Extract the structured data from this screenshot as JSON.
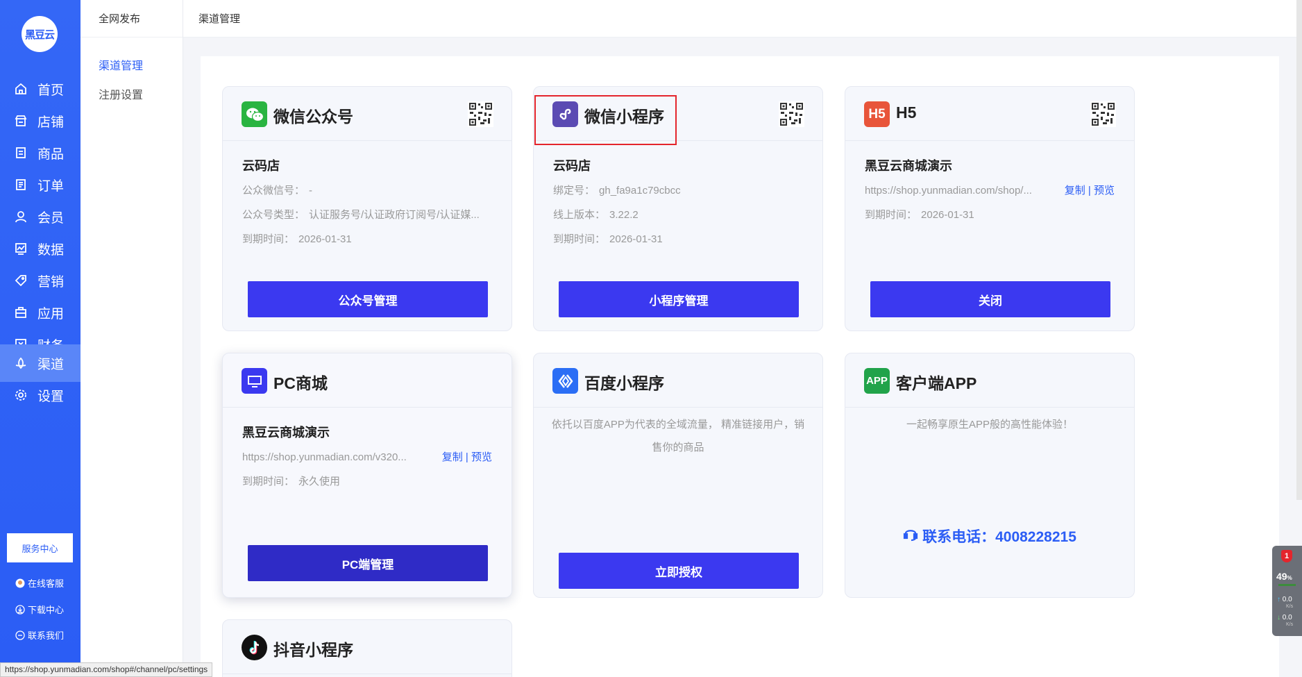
{
  "logo": {
    "text": "黑豆云"
  },
  "nav": {
    "items": [
      {
        "label": "首页",
        "icon": "home-icon"
      },
      {
        "label": "店铺",
        "icon": "store-icon"
      },
      {
        "label": "商品",
        "icon": "goods-icon"
      },
      {
        "label": "订单",
        "icon": "order-icon"
      },
      {
        "label": "会员",
        "icon": "user-icon"
      },
      {
        "label": "数据",
        "icon": "chart-icon"
      },
      {
        "label": "营销",
        "icon": "tag-icon"
      },
      {
        "label": "应用",
        "icon": "app-icon"
      },
      {
        "label": "财务",
        "icon": "finance-icon"
      },
      {
        "label": "渠道",
        "icon": "channel-icon"
      },
      {
        "label": "设置",
        "icon": "gear-icon"
      }
    ],
    "active": "渠道",
    "service_center": "服务中心",
    "bottom_links": [
      "在线客服",
      "下载中心",
      "联系我们"
    ]
  },
  "subnav": {
    "title": "全网发布",
    "items": [
      "渠道管理",
      "注册设置"
    ],
    "active": "渠道管理"
  },
  "topbar": {
    "title": "渠道管理"
  },
  "cards": {
    "wechat_oa": {
      "title": "微信公众号",
      "shop": "云码店",
      "rows": [
        {
          "k": "公众微信号：",
          "v": "-"
        },
        {
          "k": "公众号类型：",
          "v": "认证服务号/认证政府订阅号/认证媒..."
        },
        {
          "k": "到期时间：",
          "v": "2026-01-31"
        }
      ],
      "button": "公众号管理"
    },
    "wechat_mp": {
      "title": "微信小程序",
      "shop": "云码店",
      "rows": [
        {
          "k": "绑定号：",
          "v": "gh_fa9a1c79cbcc"
        },
        {
          "k": "线上版本：",
          "v": "3.22.2"
        },
        {
          "k": "到期时间：",
          "v": "2026-01-31"
        }
      ],
      "button": "小程序管理"
    },
    "h5": {
      "title": "H5",
      "icon_text": "H5",
      "shop": "黑豆云商城演示",
      "url": "https://shop.yunmadian.com/shop/...",
      "copy": "复制",
      "sep": "|",
      "preview": "预览",
      "expire_k": "到期时间：",
      "expire_v": "2026-01-31",
      "button": "关闭"
    },
    "pc": {
      "title": "PC商城",
      "shop": "黑豆云商城演示",
      "url": "https://shop.yunmadian.com/v320...",
      "copy": "复制",
      "sep": "|",
      "preview": "预览",
      "expire_k": "到期时间：",
      "expire_v": "永久使用",
      "button": "PC端管理"
    },
    "baidu": {
      "title": "百度小程序",
      "desc": "依托以百度APP为代表的全域流量， 精准链接用户，销售你的商品",
      "button": "立即授权"
    },
    "app": {
      "title": "客户端APP",
      "icon_text": "APP",
      "desc": "一起畅享原生APP般的高性能体验！",
      "phone": "联系电话：4008228215"
    },
    "douyin": {
      "title": "抖音小程序"
    }
  },
  "statusbar": {
    "url": "https://shop.yunmadian.com/shop#/channel/pc/settings"
  },
  "widget": {
    "badge": "1",
    "percent": "49",
    "unit": "%",
    "up": "0.0",
    "down": "0.0",
    "speed_unit": "K/s"
  },
  "colors": {
    "primary": "#2b5df5",
    "button": "#3b39f0",
    "highlight": "#e4252c",
    "wechat": "#2ab441",
    "miniprogram": "#5b4bb3",
    "h5": "#e8553a",
    "app": "#21a34a"
  }
}
